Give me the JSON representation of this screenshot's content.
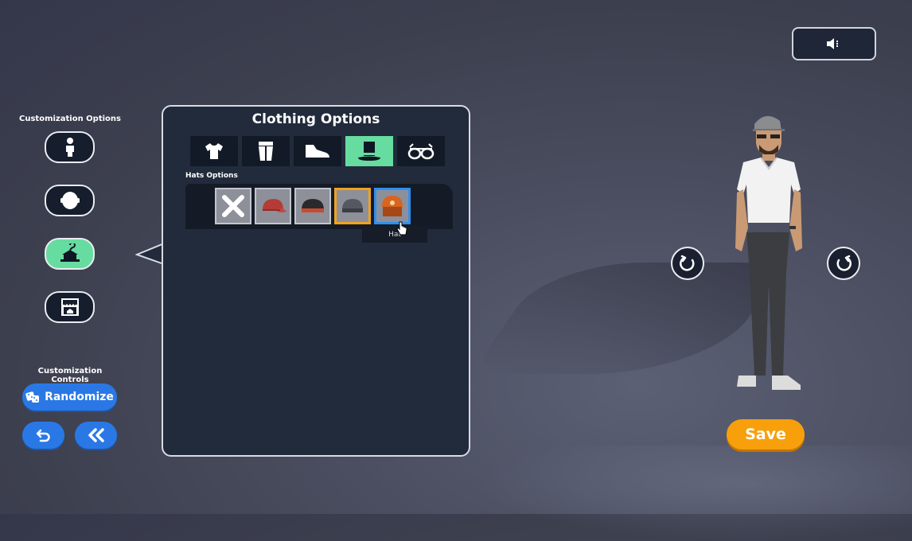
{
  "sound_button": {
    "icon": "speaker-icon"
  },
  "customization_options": {
    "title": "Customization Options",
    "buttons": [
      {
        "name": "body",
        "icon": "body-icon",
        "active": false
      },
      {
        "name": "head",
        "icon": "head-icon",
        "active": false
      },
      {
        "name": "clothing",
        "icon": "clothing-hanger-icon",
        "active": true
      },
      {
        "name": "store",
        "icon": "store-icon",
        "active": false
      }
    ]
  },
  "customization_controls": {
    "title": "Customization Controls",
    "randomize_label": "Randomize",
    "undo_icon": "undo-icon",
    "back_icon": "double-chevron-left-icon"
  },
  "clothing_panel": {
    "title": "Clothing Options",
    "tabs": [
      {
        "name": "shirt",
        "icon": "shirt-icon",
        "active": false
      },
      {
        "name": "pants",
        "icon": "pants-icon",
        "active": false
      },
      {
        "name": "shoes",
        "icon": "shoe-icon",
        "active": false
      },
      {
        "name": "hats",
        "icon": "top-hat-icon",
        "active": true
      },
      {
        "name": "glasses",
        "icon": "glasses-icon",
        "active": false
      }
    ],
    "section_label": "Hats Options",
    "items": [
      {
        "name": "none",
        "icon": "x-icon"
      },
      {
        "name": "red-cap",
        "icon": "cap-icon",
        "color": "#b53b36"
      },
      {
        "name": "black-beanie",
        "icon": "beanie-icon",
        "color": "#2a2a2c"
      },
      {
        "name": "gray-beanie",
        "icon": "beanie-icon",
        "color": "#555860",
        "equipped": true
      },
      {
        "name": "orange-helmet",
        "icon": "helmet-icon",
        "color": "#d8641e",
        "hovered": true
      }
    ],
    "tooltip": "Hat"
  },
  "rotate_left_icon": "rotate-left-icon",
  "rotate_right_icon": "rotate-right-icon",
  "save_label": "Save",
  "colors": {
    "accent_green": "#67dca0",
    "accent_blue": "#2a78e6",
    "accent_orange": "#f7a00c",
    "panel_bg": "#222b3b"
  }
}
